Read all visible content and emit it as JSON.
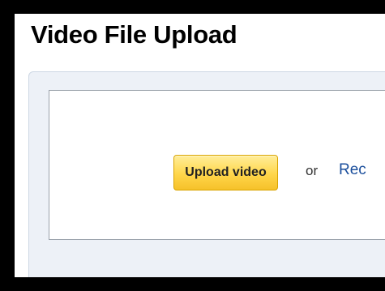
{
  "page": {
    "title": "Video File Upload"
  },
  "upload": {
    "button_label": "Upload video",
    "separator": "or",
    "record_link_label": "Rec"
  },
  "colors": {
    "button_gradient_top": "#ffee9a",
    "button_gradient_bottom": "#f6c12a",
    "link": "#1a4e9c",
    "panel_background": "#edf1f7"
  }
}
